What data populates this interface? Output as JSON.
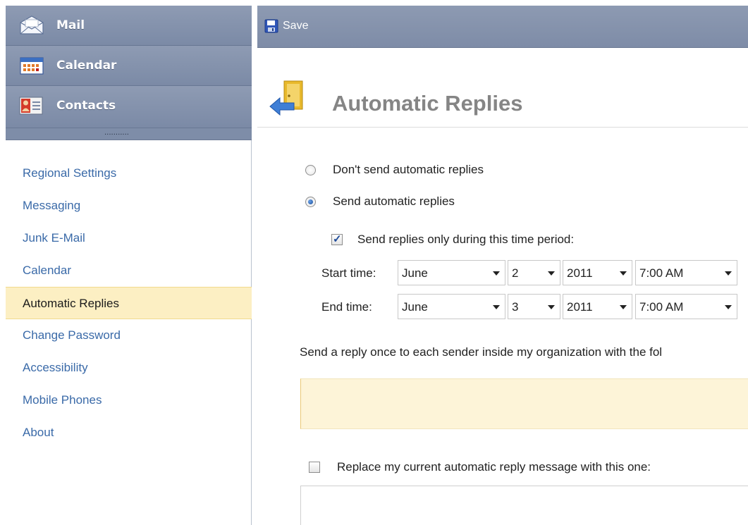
{
  "nav": {
    "buttons": [
      {
        "label": "Mail",
        "icon": "mail-icon"
      },
      {
        "label": "Calendar",
        "icon": "calendar-icon"
      },
      {
        "label": "Contacts",
        "icon": "contacts-icon"
      }
    ],
    "grip": "..........."
  },
  "options": {
    "items": [
      {
        "label": "Regional Settings"
      },
      {
        "label": "Messaging"
      },
      {
        "label": "Junk E-Mail"
      },
      {
        "label": "Calendar"
      },
      {
        "label": "Automatic Replies",
        "selected": true
      },
      {
        "label": "Change Password"
      },
      {
        "label": "Accessibility"
      },
      {
        "label": "Mobile Phones"
      },
      {
        "label": "About"
      }
    ]
  },
  "toolbar": {
    "save_label": "Save",
    "save_icon": "save-disk-icon"
  },
  "page": {
    "title": "Automatic Replies",
    "icon": "automatic-replies-icon"
  },
  "form": {
    "radio_dont_send": {
      "label": "Don't send automatic replies",
      "checked": false
    },
    "radio_send": {
      "label": "Send automatic replies",
      "checked": true
    },
    "time_period_check": {
      "label": "Send replies only during this time period:",
      "checked": true
    },
    "start": {
      "label": "Start time:",
      "month": "June",
      "day": "2",
      "year": "2011",
      "time": "7:00 AM"
    },
    "end": {
      "label": "End time:",
      "month": "June",
      "day": "3",
      "year": "2011",
      "time": "7:00 AM"
    },
    "internal_info": "Send a reply once to each sender inside my organization with the fol",
    "replace_check": {
      "label": "Replace my current automatic reply message with this one:",
      "checked": false
    }
  },
  "colors": {
    "nav_blue": "#8a97b0",
    "link_blue": "#3a6aa8",
    "selected_bg": "#fcefc3",
    "message_bg": "#fdf4d8",
    "title_gray": "#858585"
  }
}
